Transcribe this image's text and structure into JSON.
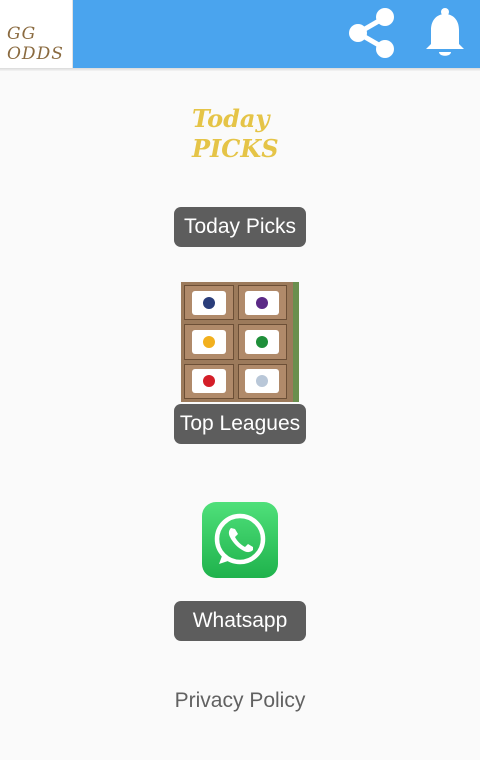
{
  "header": {
    "logo_line1": "GG",
    "logo_line2": "ODDS",
    "share_icon": "share-icon",
    "bell_icon": "bell-icon",
    "bar_color": "#4aa4ee"
  },
  "today": {
    "image_line1": "Today",
    "image_line2": "PICKS",
    "button_label": "Today Picks"
  },
  "leagues": {
    "button_label": "Top Leagues"
  },
  "whatsapp": {
    "icon": "whatsapp-icon",
    "button_label": "Whatsapp"
  },
  "footer": {
    "privacy_label": "Privacy Policy"
  }
}
